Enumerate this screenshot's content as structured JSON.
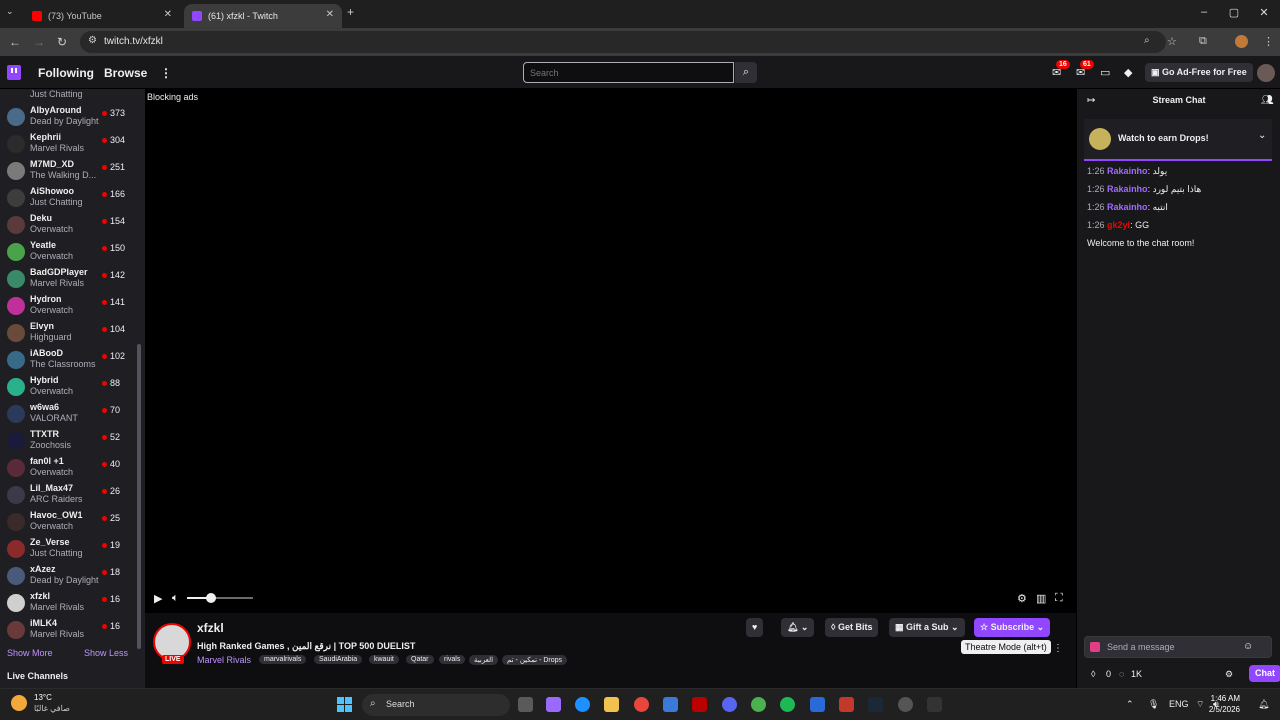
{
  "browser": {
    "tabs": [
      {
        "title": "(73) YouTube"
      },
      {
        "title": "(61) xfzkl - Twitch"
      }
    ],
    "url": "twitch.tv/xfzkl"
  },
  "topnav": {
    "following": "Following",
    "browse": "Browse",
    "search_placeholder": "Search",
    "notif_badge_1": "16",
    "notif_badge_2": "61",
    "ad_free": "Go Ad-Free for Free"
  },
  "sidebar": {
    "top_text": "Just Chatting",
    "channels": [
      {
        "name": "AlbyAround",
        "game": "Dead by Daylight",
        "viewers": "373",
        "color": "#4a6a8a"
      },
      {
        "name": "Kephrii",
        "game": "Marvel Rivals",
        "viewers": "304",
        "color": "#2b2b2b"
      },
      {
        "name": "M7MD_XD",
        "game": "The Walking D...",
        "viewers": "251",
        "color": "#7a7a7a"
      },
      {
        "name": "AiShowoo",
        "game": "Just Chatting",
        "viewers": "166",
        "color": "#3d3d3d"
      },
      {
        "name": "Deku",
        "game": "Overwatch",
        "viewers": "154",
        "color": "#5a3a3a"
      },
      {
        "name": "Yeatle",
        "game": "Overwatch",
        "viewers": "150",
        "color": "#4aa34a"
      },
      {
        "name": "BadGDPlayer",
        "game": "Marvel Rivals",
        "viewers": "142",
        "color": "#3a8a6a"
      },
      {
        "name": "Hydron",
        "game": "Overwatch",
        "viewers": "141",
        "color": "#c0309a"
      },
      {
        "name": "Elvyn",
        "game": "Highguard",
        "viewers": "104",
        "color": "#6a4a3a"
      },
      {
        "name": "iABooD",
        "game": "The Classrooms",
        "viewers": "102",
        "color": "#3a6a8a"
      },
      {
        "name": "Hybrid",
        "game": "Overwatch",
        "viewers": "88",
        "color": "#2ab08a"
      },
      {
        "name": "w6wa6",
        "game": "VALORANT",
        "viewers": "70",
        "color": "#2b3a5a"
      },
      {
        "name": "TTXTR",
        "game": "Zoochosis",
        "viewers": "52",
        "color": "#1a1a3a"
      },
      {
        "name": "fan0l +1",
        "game": "Overwatch",
        "viewers": "40",
        "color": "#5a2a3a"
      },
      {
        "name": "Lil_Max47",
        "game": "ARC Raiders",
        "viewers": "26",
        "color": "#3a3a4a"
      },
      {
        "name": "Havoc_OW1",
        "game": "Overwatch",
        "viewers": "25",
        "color": "#3a2a2a"
      },
      {
        "name": "Ze_Verse",
        "game": "Just Chatting",
        "viewers": "19",
        "color": "#8a2a2a"
      },
      {
        "name": "xAzez",
        "game": "Dead by Daylight",
        "viewers": "18",
        "color": "#4a5a7a"
      },
      {
        "name": "xfzkl",
        "game": "Marvel Rivals",
        "viewers": "16",
        "color": "#cfcfcf"
      },
      {
        "name": "iMLK4",
        "game": "Marvel Rivals",
        "viewers": "16",
        "color": "#6a3a3a"
      }
    ],
    "show_more": "Show More",
    "show_less": "Show Less",
    "live_channels": "Live Channels"
  },
  "player": {
    "blocking_ads": "Blocking ads",
    "volume_level": 0.37
  },
  "stream": {
    "streamer": "xfzkl",
    "live": "LIVE",
    "title": "High Ranked Games , نرقع المين | TOP 500 DUELIST",
    "game": "Marvel Rivals",
    "tags": [
      "marvalrivals",
      "SaudiArabia",
      "kwauit",
      "Qatar",
      "rivals",
      "العربية",
      "تمكين - تم - Drops"
    ],
    "get_bits": "Get Bits",
    "gift_sub": "Gift a Sub",
    "subscribe": "Subscribe",
    "theatre_tip": "Theatre Mode (alt+t)"
  },
  "chat": {
    "title": "Stream Chat",
    "drops_text": "Watch to earn Drops!",
    "messages": [
      {
        "time": "1:26",
        "user": "Rakainho",
        "text": ": يولد",
        "color": "#9f6bff"
      },
      {
        "time": "1:26",
        "user": "Rakainho",
        "text": ": هاذا بتيم لورد",
        "color": "#9f6bff"
      },
      {
        "time": "1:26",
        "user": "Rakainho",
        "text": ": انتبه",
        "color": "#9f6bff"
      },
      {
        "time": "1:26",
        "user": "gk2yl",
        "text": ": GG",
        "color": "#eb0400"
      }
    ],
    "welcome": "Welcome to the chat room!",
    "input_placeholder": "Send a message",
    "points": "0",
    "points_k": "1K",
    "send": "Chat"
  },
  "taskbar": {
    "temp": "13°C",
    "weather": "صافي غالبًا",
    "search": "Search",
    "lang": "ENG",
    "time": "1:46 AM",
    "date": "2/5/2026"
  }
}
